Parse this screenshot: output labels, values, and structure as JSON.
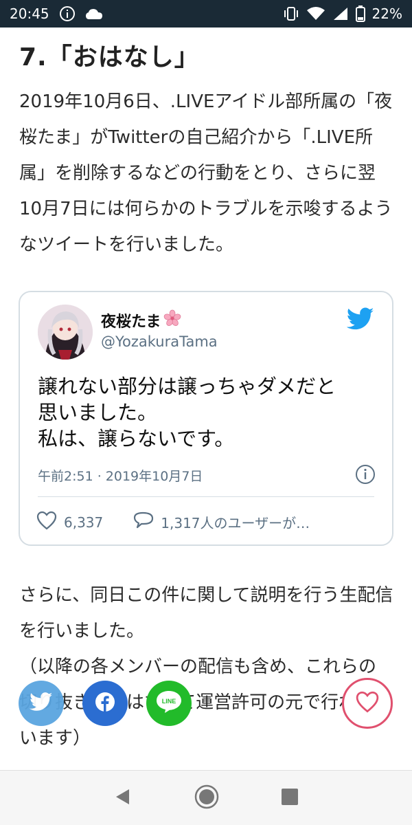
{
  "status_bar": {
    "time": "20:45",
    "battery": "22%"
  },
  "article": {
    "heading": "7.「おはなし」",
    "paragraph1": "2019年10月6日、.LIVEアイドル部所属の「夜桜たま」がTwitterの自己紹介から「.LIVE所属」を削除するなどの行動をとり、さらに翌10月7日には何らかのトラブルを示唆するようなツイートを行いました。",
    "paragraph2": "さらに、同日この件に関して説明を行う生配信を行いました。\n（以降の各メンバーの配信も含め、これらの切り抜き配信はすべて運営許可の元で行われています）"
  },
  "tweet": {
    "name": "夜桜たま",
    "handle": "@YozakuraTama",
    "text": "譲れない部分は譲っちゃダメだと\n思いました。\n私は、譲らないです。",
    "meta": "午前2:51 · 2019年10月7日",
    "likes": "6,337",
    "replies": "1,317人のユーザーが…"
  },
  "share": {
    "line_label": "LINE"
  },
  "colors": {
    "status_bar_bg": "#1a2a36",
    "twitter_blue": "#1da1f2",
    "facebook_blue": "#2b6dd1",
    "line_green": "#22bb2a",
    "heart_pink": "#e0506e"
  },
  "icons": [
    "info-icon",
    "cloud-icon",
    "vibrate-icon",
    "wifi-icon",
    "signal-icon",
    "battery-icon",
    "twitter-bird-icon",
    "heart-icon",
    "reply-icon",
    "back-icon",
    "home-icon",
    "recents-icon"
  ]
}
